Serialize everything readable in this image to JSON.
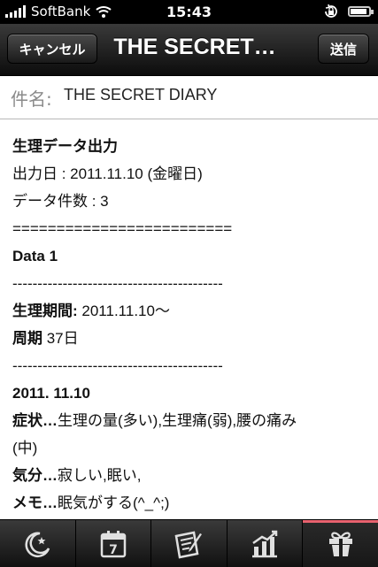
{
  "status_bar": {
    "carrier": "SoftBank",
    "time": "15:43",
    "signal_bars": 5,
    "battery_level": 0.9
  },
  "nav": {
    "cancel_label": "キャンセル",
    "title": "THE SECRET…",
    "send_label": "送信"
  },
  "subject": {
    "label": "件名:",
    "value": "THE SECRET DIARY"
  },
  "body": {
    "heading": "生理データ出力",
    "output_date": "出力日 : 2011.11.10 (金曜日)",
    "data_count": "データ件数 : 3",
    "separator_double": "=========================",
    "data_label": "Data 1",
    "separator_dash_1": "------------------------------------------",
    "period_label": "生理期間:",
    "period_value": " 2011.11.10〜",
    "cycle_label": "周期",
    "cycle_value": " 37日",
    "separator_dash_2": "------------------------------------------",
    "entry_date": "2011. 11.10",
    "symptom_label": "症状…",
    "symptom_value": "生理の量(多い),生理痛(弱),腰の痛み",
    "symptom_value_cont": "(中)",
    "mood_label": "気分…",
    "mood_value": "寂しい,眠い,",
    "memo_label": "メモ…",
    "memo_value": "眠気がする(^_^;)"
  },
  "tabbar": {
    "tabs": [
      {
        "icon": "moon-star-icon"
      },
      {
        "icon": "calendar-icon",
        "day": "7"
      },
      {
        "icon": "notes-pencil-icon"
      },
      {
        "icon": "bar-chart-icon"
      },
      {
        "icon": "gift-icon"
      }
    ],
    "active_index": 4,
    "accent_color": "#e8626f"
  }
}
